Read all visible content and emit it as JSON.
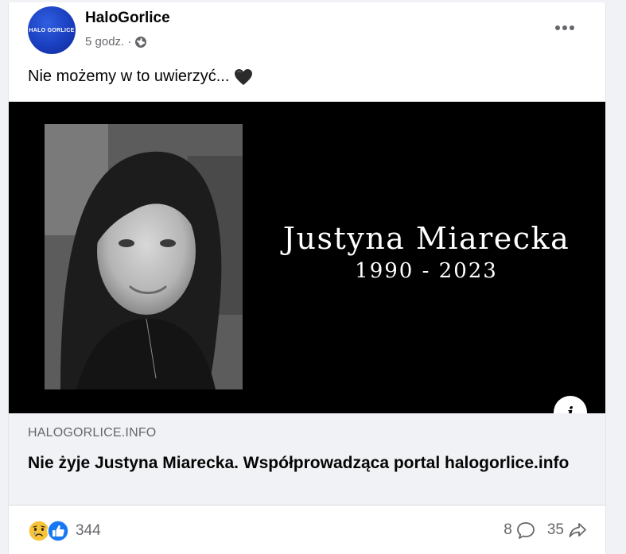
{
  "post": {
    "page_name": "HaloGorlice",
    "avatar_text": "HALO GORLICE",
    "time": "5 godz.",
    "separator": "·",
    "caption": "Nie możemy w to uwierzyć...",
    "caption_emoji": "black-heart-icon"
  },
  "image": {
    "name": "Justyna Miarecka",
    "years": "1990 - 2023",
    "info_label": "i"
  },
  "link": {
    "domain": "HALOGORLICE.INFO",
    "title": "Nie żyje Justyna Miarecka. Współprowadząca portal halogorlice.info"
  },
  "footer": {
    "reaction_count": "344",
    "comments_count": "8",
    "shares_count": "35",
    "reaction_icons": [
      "sad-icon",
      "like-icon"
    ]
  },
  "colors": {
    "avatar_blue": "#1a3fbf",
    "like_blue": "#1877f2",
    "sad_yellow": "#f7c33a",
    "secondary_text": "#65676b",
    "link_box_bg": "#f0f2f5"
  }
}
